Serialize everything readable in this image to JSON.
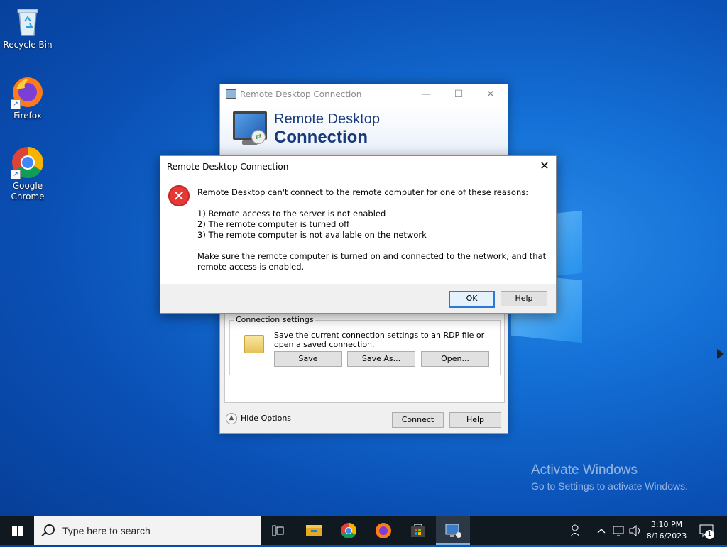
{
  "desktop": {
    "icons": [
      {
        "label": "Recycle Bin",
        "icon": "recycle-bin-icon"
      },
      {
        "label": "Firefox",
        "icon": "firefox-icon"
      },
      {
        "label": "Google Chrome",
        "icon": "chrome-icon"
      }
    ],
    "watermark": {
      "line1": "Activate Windows",
      "line2": "Go to Settings to activate Windows."
    }
  },
  "rdc_window": {
    "title": "Remote Desktop Connection",
    "banner_line1": "Remote Desktop",
    "banner_line2": "Connection",
    "connection_settings": {
      "legend": "Connection settings",
      "description": "Save the current connection settings to an RDP file or open a saved connection.",
      "save_label": "Save",
      "save_as_label": "Save As...",
      "open_label": "Open..."
    },
    "hide_options_label": "Hide Options",
    "connect_label": "Connect",
    "help_label": "Help"
  },
  "error_dialog": {
    "title": "Remote Desktop Connection",
    "intro": "Remote Desktop can't connect to the remote computer for one of these reasons:",
    "reasons": [
      "1) Remote access to the server is not enabled",
      "2) The remote computer is turned off",
      "3) The remote computer is not available on the network"
    ],
    "advice": "Make sure the remote computer is turned on and connected to the network, and that remote access is enabled.",
    "ok_label": "OK",
    "help_label": "Help",
    "close_glyph": "✕"
  },
  "taskbar": {
    "search_placeholder": "Type here to search",
    "clock_time": "3:10 PM",
    "clock_date": "8/16/2023",
    "notification_count": "1",
    "pinned": [
      "task-view-icon",
      "file-explorer-icon",
      "chrome-icon",
      "firefox-icon",
      "store-icon",
      "remote-desktop-icon"
    ]
  },
  "colors": {
    "accent": "#2c78d4",
    "error": "#e53935",
    "title_blue": "#1a3b7a"
  }
}
